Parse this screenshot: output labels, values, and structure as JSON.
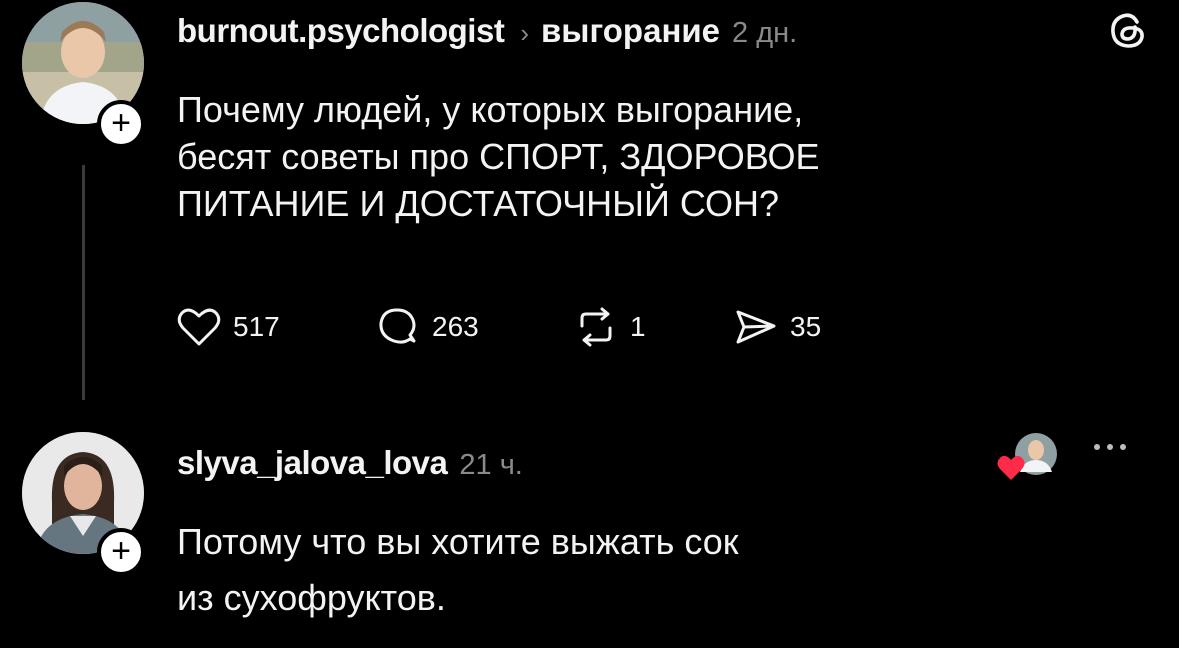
{
  "post": {
    "username": "burnout.psychologist",
    "topic": "выгорание",
    "time": "2 дн.",
    "text_lines": [
      "Почему людей, у которых выгорание,",
      "бесят советы про СПОРТ, ЗДОРОВОЕ",
      "ПИТАНИЕ И ДОСТАТОЧНЫЙ СОН?"
    ],
    "likes": "517",
    "replies": "263",
    "reposts": "1",
    "shares": "35"
  },
  "reply": {
    "username": "slyva_jalova_lova",
    "time": "21 ч.",
    "text_lines": [
      "Потому что вы хотите выжать сок",
      "из сухофруктов."
    ]
  },
  "icons": {
    "follow": "+"
  },
  "colors": {
    "background": "#000000",
    "text": "#f3f3f3",
    "muted": "#8a8a8a",
    "heart": "#ff2b49"
  }
}
